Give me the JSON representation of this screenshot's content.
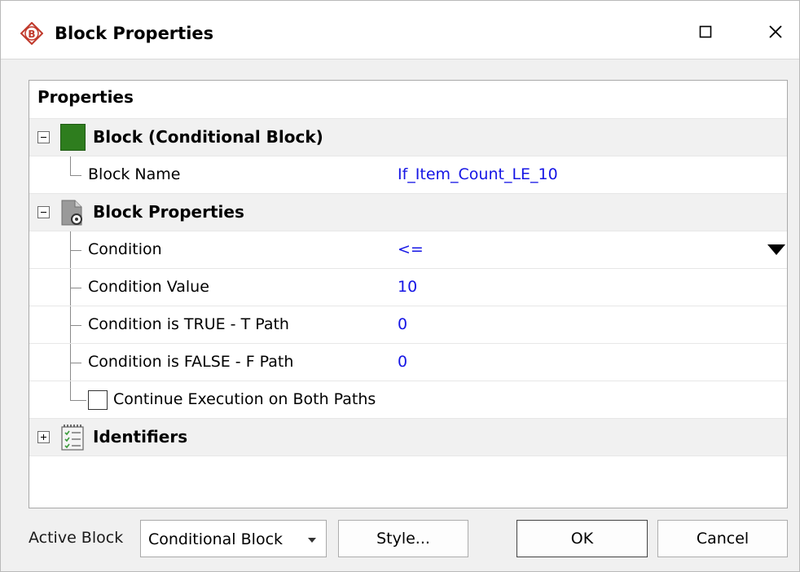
{
  "window": {
    "title": "Block Properties",
    "app_icon_letter": "B",
    "icons": {
      "app": "block-logo-icon",
      "maximize": "maximize-icon",
      "close": "close-icon"
    }
  },
  "properties": {
    "header": "Properties",
    "block_category": {
      "label": "Block (Conditional Block)",
      "color": "#2e7d1e",
      "rows": [
        {
          "label": "Block Name",
          "value": "If_Item_Count_LE_10"
        }
      ]
    },
    "block_properties_category": {
      "label": "Block Properties",
      "rows": [
        {
          "label": "Condition",
          "value": "<="
        },
        {
          "label": "Condition Value",
          "value": "10"
        },
        {
          "label": "Condition is TRUE - T Path",
          "value": "0"
        },
        {
          "label": "Condition is FALSE - F Path",
          "value": "0"
        }
      ],
      "checkbox": {
        "label": "Continue Execution on Both Paths",
        "checked": false
      }
    },
    "identifiers_category": {
      "label": "Identifiers"
    }
  },
  "footer": {
    "active_block_label": "Active Block",
    "active_block_value": "Conditional Block",
    "style_button": "Style...",
    "ok_button": "OK",
    "cancel_button": "Cancel"
  },
  "colors": {
    "value_text": "#1515e5",
    "category_bg": "#f1f1f1"
  }
}
